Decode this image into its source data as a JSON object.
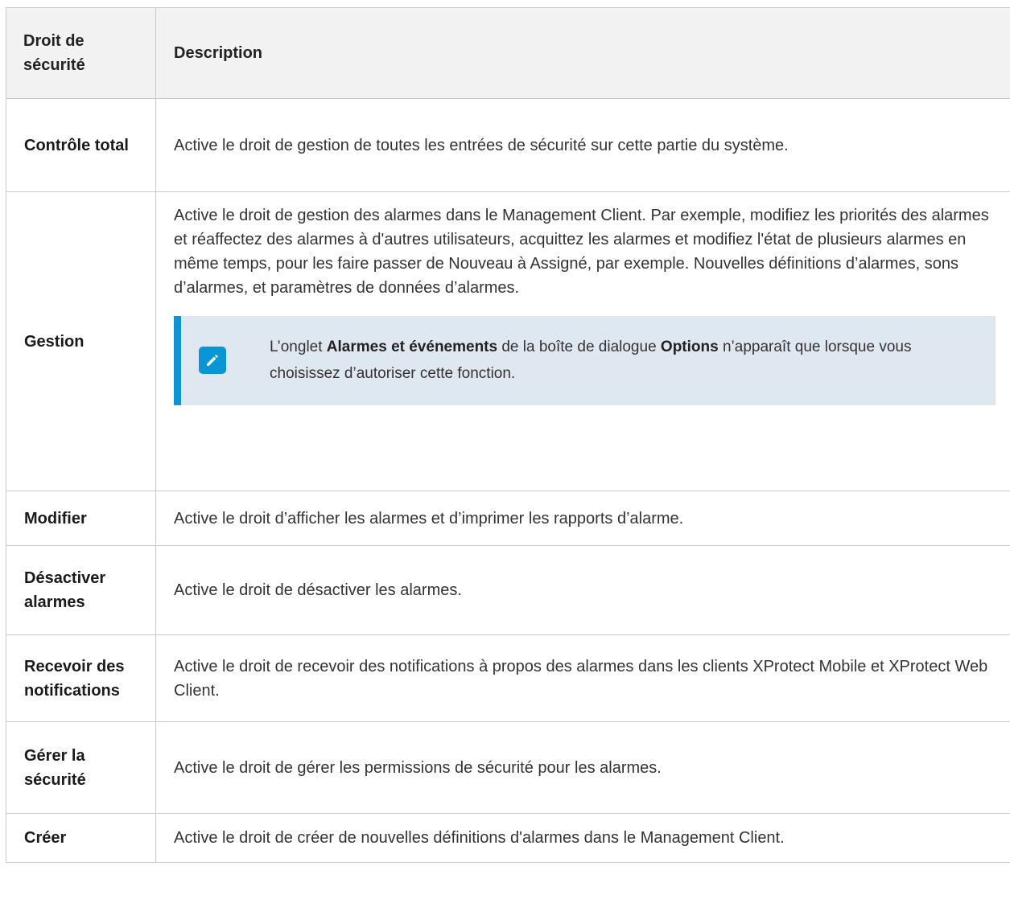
{
  "table": {
    "headers": {
      "name": "Droit de sécurité",
      "description": "Description"
    },
    "rows": [
      {
        "name": "Contrôle total",
        "description": "Active le droit de gestion de toutes les entrées de sécurité sur cette partie du système."
      },
      {
        "name": "Gestion",
        "description": "Active le droit de gestion des alarmes dans le Management Client. Par exemple, modifiez les priorités des alarmes et réaffectez des alarmes à d'autres utilisateurs, acquittez les alarmes et modifiez l'état de plusieurs alarmes en même temps, pour les faire passer de Nouveau à Assigné, par exemple. Nouvelles définitions d’alarmes, sons d’alarmes, et paramètres de données d’alarmes.",
        "note": {
          "icon": "pencil-note-icon",
          "text_before": "L’onglet ",
          "bold_1": "Alarmes et événements",
          "text_middle": " de la boîte de dialogue ",
          "bold_2": "Options",
          "text_after": " n’apparaît que lorsque vous choisissez d’autoriser cette fonction."
        }
      },
      {
        "name": "Modifier",
        "description": "Active le droit d’afficher les alarmes et d’imprimer les rapports d’alarme."
      },
      {
        "name": "Désactiver alarmes",
        "description": "Active le droit de désactiver les alarmes."
      },
      {
        "name": "Recevoir des notifications",
        "description": "Active le droit de recevoir des notifications à propos des alarmes dans les clients XProtect Mobile et XProtect Web Client."
      },
      {
        "name": "Gérer la sécurité",
        "description": "Active le droit de gérer les permissions de sécurité pour les alarmes."
      },
      {
        "name": "Créer",
        "description": "Active le droit de créer de nouvelles définitions d'alarmes dans le Management Client."
      }
    ]
  },
  "colors": {
    "accent": "#0a95d6",
    "note_background": "#dfe7f1",
    "header_background": "#f2f2f2",
    "border": "#c9c9c9"
  }
}
